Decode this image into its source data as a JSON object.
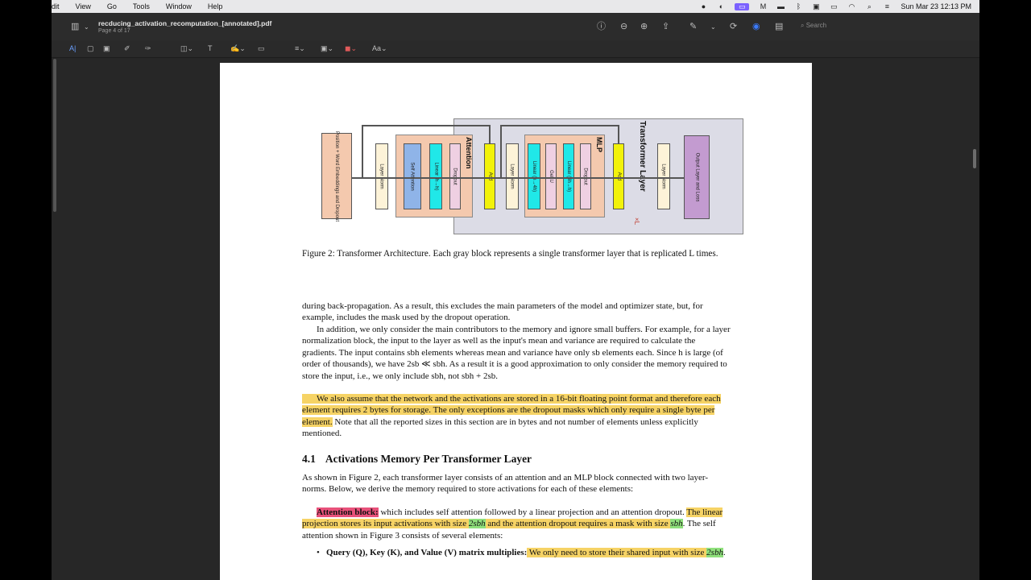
{
  "menubar": {
    "items": [
      "dit",
      "View",
      "Go",
      "Tools",
      "Window",
      "Help"
    ],
    "clock": "Sun Mar 23  12:13 PM"
  },
  "window": {
    "doc_title": "recducing_activation_recomputation_[annotated].pdf",
    "page_info": "Page 4 of 17",
    "search_placeholder": "Search"
  },
  "figure": {
    "labels": {
      "embed": "Position + Word Embeddings and Dropout",
      "ln1": "Layer Norm",
      "self_attn": "Self Attention",
      "linear1": "Linear (h→h)",
      "dropout1": "Dropout",
      "attention": "Attention",
      "add1": "Add",
      "ln2": "Layer Norm",
      "linear2": "Linear (h→4h)",
      "gelu": "GeLU",
      "linear3": "Linear (4h→h)",
      "dropout2": "Dropout",
      "mlp": "MLP",
      "add2": "Add",
      "transformer_layer": "Transformer Layer",
      "times_l": "×L",
      "ln3": "Layer Norm",
      "output": "Output Layer and Loss"
    },
    "caption": "Figure 2:  Transformer Architecture.  Each gray block represents a single transformer layer that is replicated L times."
  },
  "text": {
    "p1": "during back-propagation. As a result, this excludes the main parameters of the model and optimizer state, but, for example, includes the mask used by the dropout operation.",
    "p2": "In addition, we only consider the main contributors to the memory and ignore small buffers. For example, for a layer normalization block, the input to the layer as well as the input's mean and variance are required to calculate the gradients. The input contains sbh elements whereas mean and variance have only sb elements each. Since h is large (of order of thousands), we have 2sb ≪ sbh. As a result it is a good approximation to only consider the memory required to store the input, i.e., we only include sbh, not sbh + 2sb.",
    "p3_hl": "We also assume that the network and the activations are stored in a 16-bit floating point format and therefore each element requires 2 bytes for storage. The only exceptions are the dropout masks which only require a single byte per element.",
    "p3_rest": " Note that all the reported sizes in this section are in bytes and not number of elements unless explicitly mentioned.",
    "section_num": "4.1",
    "section_title": "Activations Memory Per Transformer Layer",
    "p4": "As shown in Figure 2, each transformer layer consists of an attention and an MLP block connected with two layer-norms. Below, we derive the memory required to store activations for each of these elements:",
    "p5_label": "Attention block:",
    "p5_a": " which includes self attention followed by a linear projection and an attention dropout. ",
    "p5_hl1": "The linear projection stores its input activations with size ",
    "p5_g1": "2sbh",
    "p5_hl2": " and the attention dropout requires a mask with size ",
    "p5_g2": "sbh",
    "p5_b": " The self attention shown in Figure 3 consists of several elements:",
    "bullet1_bold": "Query (Q), Key (K), and Value (V) matrix multiplies:",
    "bullet1_hl": " We only need to store their shared input with size ",
    "bullet1_g": "2sbh"
  },
  "colors": {
    "highlight_yellow": "#f6d365",
    "highlight_green": "#8fe07c",
    "highlight_red": "#e8517a",
    "accent": "#7b61ff"
  }
}
